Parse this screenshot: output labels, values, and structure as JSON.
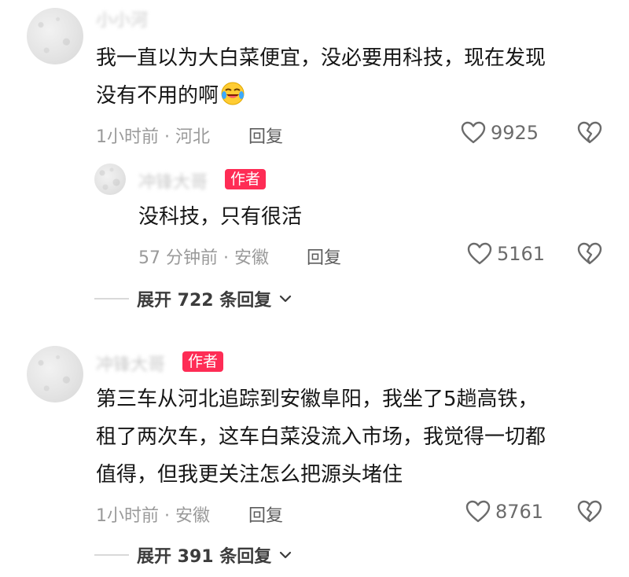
{
  "comments": [
    {
      "text_lines": [
        "我一直以为大白菜便宜，没必要用科技，现在发现",
        "没有不用的啊"
      ],
      "emoji": "crying-laughing-emoji",
      "time": "1小时前 · 河北",
      "reply_label": "回复",
      "likes": "9925",
      "replies": [
        {
          "badge": "作者",
          "text": "没科技，只有很活",
          "time": "57 分钟前 · 安徽",
          "reply_label": "回复",
          "likes": "5161"
        }
      ],
      "expand_label": "展开 722 条回复"
    },
    {
      "badge": "作者",
      "text_lines": [
        "第三车从河北追踪到安徽阜阳，我坐了5趟高铁，",
        "租了两次车，这车白菜没流入市场，我觉得一切都",
        "值得，但我更关注怎么把源头堵住"
      ],
      "time": "1小时前 · 安徽",
      "reply_label": "回复",
      "likes": "8761",
      "expand_label": "展开 391 条回复"
    }
  ],
  "colors": {
    "badge": "#fe2c55",
    "meta": "#9a9a9a",
    "text": "#161616"
  },
  "icons": [
    "heart-outline-icon",
    "broken-heart-icon",
    "chevron-down-icon"
  ]
}
